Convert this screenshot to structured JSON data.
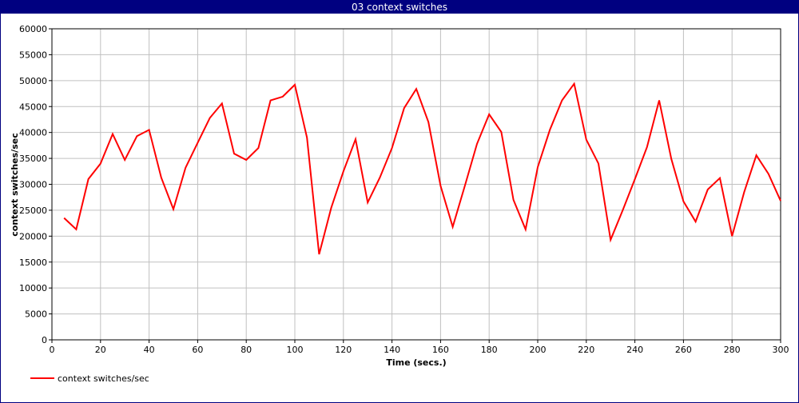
{
  "window": {
    "title": "03 context switches"
  },
  "chart_data": {
    "type": "line",
    "title": "03 context switches",
    "xlabel": "Time (secs.)",
    "ylabel": "context switches/sec",
    "xlim": [
      0,
      300
    ],
    "ylim": [
      0,
      60000
    ],
    "xticks": [
      0,
      20,
      40,
      60,
      80,
      100,
      120,
      140,
      160,
      180,
      200,
      220,
      240,
      260,
      280,
      300
    ],
    "yticks": [
      0,
      5000,
      10000,
      15000,
      20000,
      25000,
      30000,
      35000,
      40000,
      45000,
      50000,
      55000,
      60000
    ],
    "grid": true,
    "legend_position": "bottom-left",
    "series": [
      {
        "name": "context switches/sec",
        "color": "#ff0000",
        "x": [
          5,
          10,
          15,
          20,
          25,
          30,
          35,
          40,
          45,
          50,
          55,
          60,
          65,
          70,
          75,
          80,
          85,
          90,
          95,
          100,
          105,
          110,
          115,
          120,
          125,
          130,
          135,
          140,
          145,
          150,
          155,
          160,
          165,
          170,
          175,
          180,
          185,
          190,
          195,
          200,
          205,
          210,
          215,
          220,
          225,
          230,
          235,
          240,
          245,
          250,
          255,
          260,
          265,
          270,
          275,
          280,
          285,
          290,
          295,
          300
        ],
        "values": [
          23500,
          21300,
          31000,
          34000,
          39700,
          34700,
          39300,
          40500,
          31300,
          25200,
          33200,
          38000,
          42800,
          45600,
          35900,
          34700,
          37000,
          46200,
          46900,
          49200,
          39000,
          16500,
          25500,
          32500,
          38700,
          26500,
          31300,
          37000,
          44700,
          48400,
          42000,
          29700,
          21800,
          29700,
          37800,
          43500,
          40100,
          27000,
          21300,
          33300,
          40500,
          46200,
          49400,
          38600,
          34000,
          19300,
          25000,
          31000,
          37200,
          46200,
          34900,
          26700,
          22800,
          29000,
          31200,
          20000,
          28500,
          35600,
          32000,
          26800
        ]
      }
    ]
  }
}
